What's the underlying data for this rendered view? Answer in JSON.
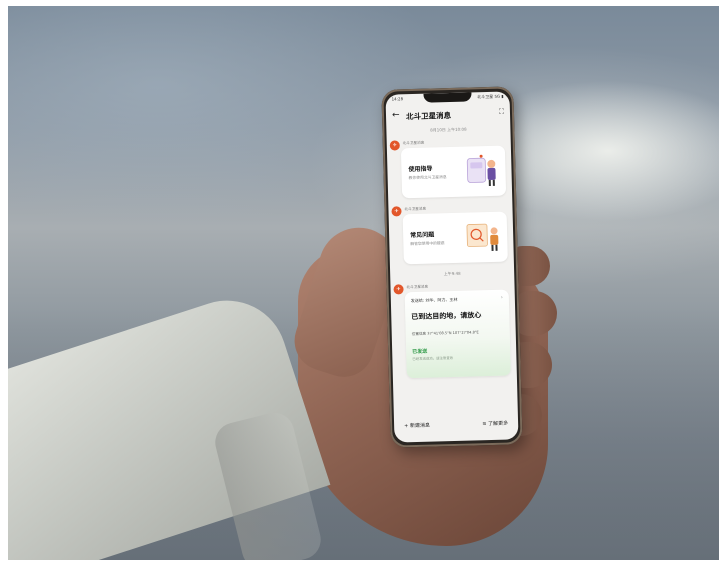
{
  "status": {
    "time": "14:28",
    "right": "北斗卫星 5G ▮"
  },
  "header": {
    "title": "北斗卫星消息",
    "back_icon": "arrow-left-icon",
    "expand_icon": "expand-icon"
  },
  "timestamps": [
    "8月10日 上午10:08",
    "上午9:48"
  ],
  "messages": [
    {
      "sender": "北斗卫星消息",
      "title": "使用指导",
      "subtitle": "教你使用北斗卫星消息"
    },
    {
      "sender": "北斗卫星消息",
      "title": "常见问题",
      "subtitle": "解答您使用中的疑惑"
    },
    {
      "sender": "北斗卫星消息",
      "recipients": "发送给: 刘华、阿力、王林",
      "text": "已到达目的地，请放心",
      "location": "位置信息  37°41'08.5\"N  107°27'04.8\"E",
      "status": "已发送",
      "status_sub": "已经发送成功，请注意查收"
    }
  ],
  "bottom": {
    "new": "+ 新建消息",
    "more": "≡ 了解更多"
  },
  "colors": {
    "accent": "#e2572b",
    "sent": "#2f9a48"
  }
}
